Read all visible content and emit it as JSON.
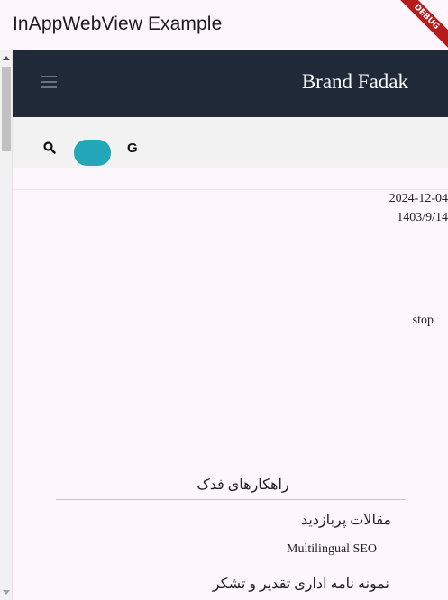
{
  "app": {
    "title": "InAppWebView Example",
    "debug_banner": "DEBUG"
  },
  "site": {
    "brand": "Brand Fadak",
    "menu_icon": "hamburger-menu-icon",
    "toolbar": {
      "truncated_text": "...",
      "search_icon": "search-icon",
      "toggle_color": "#22a8b8",
      "g_label": "G"
    },
    "dates": {
      "gregorian": "2024-12-04",
      "jalali": "1403/9/14"
    },
    "stop_label": "stop",
    "footer": {
      "title": "راهکارهای فدک",
      "links": [
        "مقالات پربازدید",
        "Multilingual SEO",
        "نمونه نامه اداری تقدیر و تشکر"
      ]
    }
  },
  "colors": {
    "header_bg": "#1f2937",
    "page_bg": "#fdf7fd"
  }
}
